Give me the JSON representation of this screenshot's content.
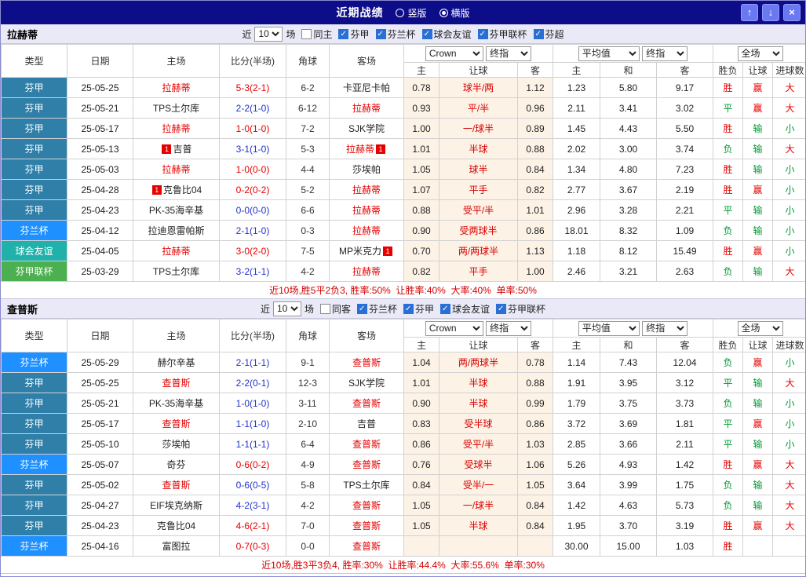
{
  "titlebar": {
    "title": "近期战绩",
    "layout_options": [
      {
        "label": "竖版",
        "selected": false
      },
      {
        "label": "横版",
        "selected": true
      }
    ],
    "buttons": {
      "up": "↑",
      "down": "↓",
      "close": "×"
    }
  },
  "colors": {
    "titlebar_bg": "#0d0d8a",
    "section_bar_bg": "#e9e9f7",
    "positive": "#e60000",
    "negative": "#009933",
    "focus_team": "#e60000",
    "team_link": "#222222",
    "handicap": "#d80000",
    "score_win": "#e60000",
    "score_lose": "#2233cc",
    "odds_column_bg": "#fdf2e6",
    "league": {
      "芬甲": "#2f7fa8",
      "芬兰杯": "#1e90ff",
      "球会友谊": "#20b2aa",
      "芬甲联杯": "#4caf50"
    }
  },
  "table": {
    "selects": {
      "bookmaker": "Crown",
      "odds_time": "终指",
      "average": "平均值",
      "avg_time": "终指",
      "scope": "全场"
    },
    "headers": {
      "type": "类型",
      "date": "日期",
      "home": "主场",
      "score": "比分(半场)",
      "corners": "角球",
      "away": "客场",
      "sub": [
        "主",
        "让球",
        "客",
        "主",
        "和",
        "客",
        "胜负",
        "让球",
        "进球数"
      ]
    }
  },
  "sections": [
    {
      "team": "拉赫蒂",
      "filter": {
        "near": "近",
        "count": "10",
        "games": "场",
        "same": {
          "label": "同主",
          "checked": false
        },
        "leagues": [
          {
            "label": "芬甲",
            "checked": true
          },
          {
            "label": "芬兰杯",
            "checked": true
          },
          {
            "label": "球会友谊",
            "checked": true
          },
          {
            "label": "芬甲联杯",
            "checked": true
          },
          {
            "label": "芬超",
            "checked": true
          }
        ]
      },
      "rows": [
        {
          "type": "芬甲",
          "date": "25-05-25",
          "home": "拉赫蒂",
          "home_focus": true,
          "score": "5-3(2-1)",
          "score_red": true,
          "corners": "6-2",
          "away": "卡亚尼卡帕",
          "odds": [
            "0.78",
            "球半/两",
            "1.12"
          ],
          "avg": [
            "1.23",
            "5.80",
            "9.17"
          ],
          "result": "胜",
          "handicap_result": "赢",
          "goals": "大"
        },
        {
          "type": "芬甲",
          "date": "25-05-21",
          "home": "TPS土尔库",
          "score": "2-2(1-0)",
          "score_red": false,
          "corners": "6-12",
          "away": "拉赫蒂",
          "away_focus": true,
          "odds": [
            "0.93",
            "平/半",
            "0.96"
          ],
          "avg": [
            "2.11",
            "3.41",
            "3.02"
          ],
          "result": "平",
          "handicap_result": "赢",
          "goals": "大"
        },
        {
          "type": "芬甲",
          "date": "25-05-17",
          "home": "拉赫蒂",
          "home_focus": true,
          "score": "1-0(1-0)",
          "score_red": true,
          "corners": "7-2",
          "away": "SJK学院",
          "odds": [
            "1.00",
            "一/球半",
            "0.89"
          ],
          "avg": [
            "1.45",
            "4.43",
            "5.50"
          ],
          "result": "胜",
          "handicap_result": "输",
          "goals": "小"
        },
        {
          "type": "芬甲",
          "date": "25-05-13",
          "home": "吉普",
          "home_card": "1",
          "score": "3-1(1-0)",
          "score_red": false,
          "corners": "5-3",
          "away": "拉赫蒂",
          "away_focus": true,
          "away_card": "1",
          "odds": [
            "1.01",
            "半球",
            "0.88"
          ],
          "avg": [
            "2.02",
            "3.00",
            "3.74"
          ],
          "result": "负",
          "handicap_result": "输",
          "goals": "大"
        },
        {
          "type": "芬甲",
          "date": "25-05-03",
          "home": "拉赫蒂",
          "home_focus": true,
          "score": "1-0(0-0)",
          "score_red": true,
          "corners": "4-4",
          "away": "莎埃帕",
          "odds": [
            "1.05",
            "球半",
            "0.84"
          ],
          "avg": [
            "1.34",
            "4.80",
            "7.23"
          ],
          "result": "胜",
          "handicap_result": "输",
          "goals": "小"
        },
        {
          "type": "芬甲",
          "date": "25-04-28",
          "home": "克鲁比04",
          "home_card": "1",
          "score": "0-2(0-2)",
          "score_red": true,
          "corners": "5-2",
          "away": "拉赫蒂",
          "away_focus": true,
          "odds": [
            "1.07",
            "平手",
            "0.82"
          ],
          "avg": [
            "2.77",
            "3.67",
            "2.19"
          ],
          "result": "胜",
          "handicap_result": "赢",
          "goals": "小"
        },
        {
          "type": "芬甲",
          "date": "25-04-23",
          "home": "PK-35海辛基",
          "score": "0-0(0-0)",
          "score_red": false,
          "corners": "6-6",
          "away": "拉赫蒂",
          "away_focus": true,
          "odds": [
            "0.88",
            "受平/半",
            "1.01"
          ],
          "avg": [
            "2.96",
            "3.28",
            "2.21"
          ],
          "result": "平",
          "handicap_result": "输",
          "goals": "小"
        },
        {
          "type": "芬兰杯",
          "date": "25-04-12",
          "home": "拉迪恩雷帕斯",
          "score": "2-1(1-0)",
          "score_red": false,
          "corners": "0-3",
          "away": "拉赫蒂",
          "away_focus": true,
          "odds": [
            "0.90",
            "受两球半",
            "0.86"
          ],
          "avg": [
            "18.01",
            "8.32",
            "1.09"
          ],
          "result": "负",
          "handicap_result": "输",
          "goals": "小"
        },
        {
          "type": "球会友谊",
          "date": "25-04-05",
          "home": "拉赫蒂",
          "home_focus": true,
          "score": "3-0(2-0)",
          "score_red": true,
          "corners": "7-5",
          "away": "MP米克力",
          "away_card": "1",
          "odds": [
            "0.70",
            "两/两球半",
            "1.13"
          ],
          "avg": [
            "1.18",
            "8.12",
            "15.49"
          ],
          "result": "胜",
          "handicap_result": "赢",
          "goals": "小"
        },
        {
          "type": "芬甲联杯",
          "date": "25-03-29",
          "home": "TPS土尔库",
          "score": "3-2(1-1)",
          "score_red": false,
          "corners": "4-2",
          "away": "拉赫蒂",
          "away_focus": true,
          "odds": [
            "0.82",
            "平手",
            "1.00"
          ],
          "avg": [
            "2.46",
            "3.21",
            "2.63"
          ],
          "result": "负",
          "handicap_result": "输",
          "goals": "大"
        }
      ],
      "summary": "近10场,胜5平2负3, 胜率:50%  让胜率:40%  大率:40%  单率:50%"
    },
    {
      "team": "查普斯",
      "filter": {
        "near": "近",
        "count": "10",
        "games": "场",
        "same": {
          "label": "同客",
          "checked": false
        },
        "leagues": [
          {
            "label": "芬兰杯",
            "checked": true
          },
          {
            "label": "芬甲",
            "checked": true
          },
          {
            "label": "球会友谊",
            "checked": true
          },
          {
            "label": "芬甲联杯",
            "checked": true
          }
        ]
      },
      "rows": [
        {
          "type": "芬兰杯",
          "date": "25-05-29",
          "home": "赫尔辛基",
          "score": "2-1(1-1)",
          "score_red": false,
          "corners": "9-1",
          "away": "查普斯",
          "away_focus": true,
          "odds": [
            "1.04",
            "两/两球半",
            "0.78"
          ],
          "avg": [
            "1.14",
            "7.43",
            "12.04"
          ],
          "result": "负",
          "handicap_result": "赢",
          "goals": "小"
        },
        {
          "type": "芬甲",
          "date": "25-05-25",
          "home": "查普斯",
          "home_focus": true,
          "score": "2-2(0-1)",
          "score_red": false,
          "corners": "12-3",
          "away": "SJK学院",
          "odds": [
            "1.01",
            "半球",
            "0.88"
          ],
          "avg": [
            "1.91",
            "3.95",
            "3.12"
          ],
          "result": "平",
          "handicap_result": "输",
          "goals": "大"
        },
        {
          "type": "芬甲",
          "date": "25-05-21",
          "home": "PK-35海辛基",
          "score": "1-0(1-0)",
          "score_red": false,
          "corners": "3-11",
          "away": "查普斯",
          "away_focus": true,
          "odds": [
            "0.90",
            "半球",
            "0.99"
          ],
          "avg": [
            "1.79",
            "3.75",
            "3.73"
          ],
          "result": "负",
          "handicap_result": "输",
          "goals": "小"
        },
        {
          "type": "芬甲",
          "date": "25-05-17",
          "home": "查普斯",
          "home_focus": true,
          "score": "1-1(1-0)",
          "score_red": false,
          "corners": "2-10",
          "away": "吉普",
          "odds": [
            "0.83",
            "受半球",
            "0.86"
          ],
          "avg": [
            "3.72",
            "3.69",
            "1.81"
          ],
          "result": "平",
          "handicap_result": "赢",
          "goals": "小"
        },
        {
          "type": "芬甲",
          "date": "25-05-10",
          "home": "莎埃帕",
          "score": "1-1(1-1)",
          "score_red": false,
          "corners": "6-4",
          "away": "查普斯",
          "away_focus": true,
          "odds": [
            "0.86",
            "受平/半",
            "1.03"
          ],
          "avg": [
            "2.85",
            "3.66",
            "2.11"
          ],
          "result": "平",
          "handicap_result": "输",
          "goals": "小"
        },
        {
          "type": "芬兰杯",
          "date": "25-05-07",
          "home": "奇芬",
          "score": "0-6(0-2)",
          "score_red": true,
          "corners": "4-9",
          "away": "查普斯",
          "away_focus": true,
          "odds": [
            "0.76",
            "受球半",
            "1.06"
          ],
          "avg": [
            "5.26",
            "4.93",
            "1.42"
          ],
          "result": "胜",
          "handicap_result": "赢",
          "goals": "大"
        },
        {
          "type": "芬甲",
          "date": "25-05-02",
          "home": "查普斯",
          "home_focus": true,
          "score": "0-6(0-5)",
          "score_red": false,
          "corners": "5-8",
          "away": "TPS土尔库",
          "odds": [
            "0.84",
            "受半/一",
            "1.05"
          ],
          "avg": [
            "3.64",
            "3.99",
            "1.75"
          ],
          "result": "负",
          "handicap_result": "输",
          "goals": "大"
        },
        {
          "type": "芬甲",
          "date": "25-04-27",
          "home": "EIF埃克纳斯",
          "score": "4-2(3-1)",
          "score_red": false,
          "corners": "4-2",
          "away": "查普斯",
          "away_focus": true,
          "odds": [
            "1.05",
            "一/球半",
            "0.84"
          ],
          "avg": [
            "1.42",
            "4.63",
            "5.73"
          ],
          "result": "负",
          "handicap_result": "输",
          "goals": "大"
        },
        {
          "type": "芬甲",
          "date": "25-04-23",
          "home": "克鲁比04",
          "score": "4-6(2-1)",
          "score_red": true,
          "corners": "7-0",
          "away": "查普斯",
          "away_focus": true,
          "odds": [
            "1.05",
            "半球",
            "0.84"
          ],
          "avg": [
            "1.95",
            "3.70",
            "3.19"
          ],
          "result": "胜",
          "handicap_result": "赢",
          "goals": "大"
        },
        {
          "type": "芬兰杯",
          "date": "25-04-16",
          "home": "富图拉",
          "score": "0-7(0-3)",
          "score_red": true,
          "corners": "0-0",
          "away": "查普斯",
          "away_focus": true,
          "odds": [
            "",
            "",
            ""
          ],
          "avg": [
            "30.00",
            "15.00",
            "1.03"
          ],
          "result": "胜",
          "handicap_result": "",
          "goals": ""
        }
      ],
      "summary": "近10场,胜3平3负4, 胜率:30%  让胜率:44.4%  大率:55.6%  单率:30%"
    }
  ]
}
